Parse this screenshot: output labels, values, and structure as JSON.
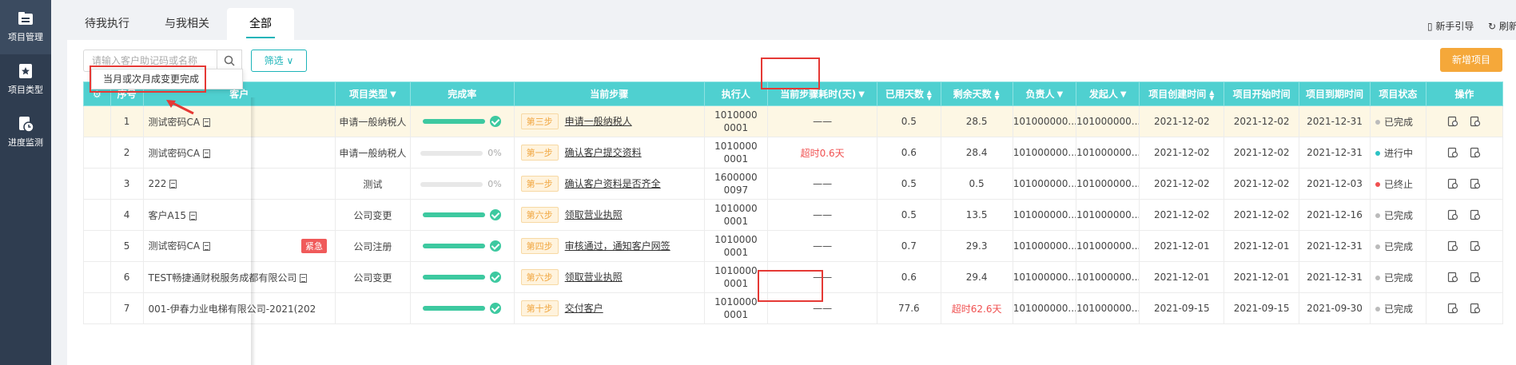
{
  "sidebar": {
    "items": [
      {
        "label": "项目管理"
      },
      {
        "label": "项目类型"
      },
      {
        "label": "进度监测"
      }
    ]
  },
  "tabs": [
    {
      "label": "待我执行"
    },
    {
      "label": "与我相关"
    },
    {
      "label": "全部"
    }
  ],
  "toolbar": {
    "guide_label": "新手引导",
    "refresh_label": "刷新",
    "search_placeholder": "请输入客户助记码或名称",
    "filter_label": "筛选",
    "new_label": "新增项目"
  },
  "tooltip": {
    "text": "当月或次月成变更完成"
  },
  "table": {
    "headers": [
      "",
      "序号",
      "客户",
      "项目类型",
      "完成率",
      "当前步骤",
      "执行人",
      "当前步骤耗时(天)",
      "已用天数",
      "剩余天数",
      "负责人",
      "发起人",
      "项目创建时间",
      "项目开始时间",
      "项目到期时间",
      "项目状态",
      "操作"
    ],
    "rows": [
      {
        "no": "1",
        "client": "测试密码CA",
        "type": "申请一般纳税人",
        "progress": 100,
        "pct": "",
        "step": "第三步",
        "step_name": "申请一般纳税人",
        "executor": "10100000001",
        "elapsed": "——",
        "used": "0.5",
        "remain": "28.5",
        "owner": "101000000...",
        "initiator": "101000000...",
        "created": "2021-12-02",
        "start": "2021-12-02",
        "due": "2021-12-31",
        "status": "已完成",
        "status_color": "#bbbbbb",
        "urgent": ""
      },
      {
        "no": "2",
        "client": "测试密码CA",
        "type": "申请一般纳税人",
        "progress": 0,
        "pct": "0%",
        "step": "第一步",
        "step_name": "确认客户提交资料",
        "executor": "10100000001",
        "elapsed": "超时0.6天",
        "used": "0.6",
        "remain": "28.4",
        "owner": "101000000...",
        "initiator": "101000000...",
        "created": "2021-12-02",
        "start": "2021-12-02",
        "due": "2021-12-31",
        "status": "进行中",
        "status_color": "#2cc2c4",
        "urgent": ""
      },
      {
        "no": "3",
        "client": "222",
        "type": "测试",
        "progress": 0,
        "pct": "0%",
        "step": "第一步",
        "step_name": "确认客户资料是否齐全",
        "executor": "16000000097",
        "elapsed": "——",
        "used": "0.5",
        "remain": "0.5",
        "owner": "101000000...",
        "initiator": "101000000...",
        "created": "2021-12-02",
        "start": "2021-12-02",
        "due": "2021-12-03",
        "status": "已终止",
        "status_color": "#f05050",
        "urgent": ""
      },
      {
        "no": "4",
        "client": "客户A15",
        "type": "公司变更",
        "progress": 100,
        "pct": "",
        "step": "第六步",
        "step_name": "领取营业执照",
        "executor": "10100000001",
        "elapsed": "——",
        "used": "0.5",
        "remain": "13.5",
        "owner": "101000000...",
        "initiator": "101000000...",
        "created": "2021-12-02",
        "start": "2021-12-02",
        "due": "2021-12-16",
        "status": "已完成",
        "status_color": "#bbbbbb",
        "urgent": ""
      },
      {
        "no": "5",
        "client": "测试密码CA",
        "type": "公司注册",
        "progress": 100,
        "pct": "",
        "step": "第四步",
        "step_name": "审核通过，通知客户网签",
        "executor": "10100000001",
        "elapsed": "——",
        "used": "0.7",
        "remain": "29.3",
        "owner": "101000000...",
        "initiator": "101000000...",
        "created": "2021-12-01",
        "start": "2021-12-01",
        "due": "2021-12-31",
        "status": "已完成",
        "status_color": "#bbbbbb",
        "urgent": "紧急"
      },
      {
        "no": "6",
        "client": "TEST畅捷通财税服务成都有限公司",
        "type": "公司变更",
        "progress": 100,
        "pct": "",
        "step": "第六步",
        "step_name": "领取营业执照",
        "executor": "10100000001",
        "elapsed": "——",
        "used": "0.6",
        "remain": "29.4",
        "owner": "101000000...",
        "initiator": "101000000...",
        "created": "2021-12-01",
        "start": "2021-12-01",
        "due": "2021-12-31",
        "status": "已完成",
        "status_color": "#bbbbbb",
        "urgent": ""
      },
      {
        "no": "7",
        "client": "001-伊春力业电梯有限公司-2021(202",
        "type": "",
        "progress": 100,
        "pct": "",
        "step": "第十步",
        "step_name": "交付客户",
        "executor": "10100000001",
        "elapsed": "——",
        "used": "77.6",
        "remain": "超时62.6天",
        "owner": "101000000...",
        "initiator": "101000000...",
        "created": "2021-09-15",
        "start": "2021-09-15",
        "due": "2021-09-30",
        "status": "已完成",
        "status_color": "#bbbbbb",
        "urgent": ""
      }
    ]
  }
}
